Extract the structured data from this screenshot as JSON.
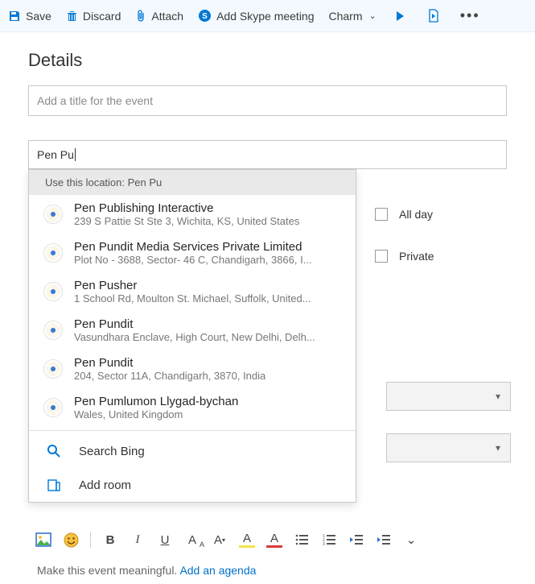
{
  "toolbar": {
    "save": "Save",
    "discard": "Discard",
    "attach": "Attach",
    "skype": "Add Skype meeting",
    "charm": "Charm"
  },
  "heading": "Details",
  "title_placeholder": "Add a title for the event",
  "location_value": "Pen Pu",
  "dropdown": {
    "use_this_prefix": "Use this location: ",
    "use_this_value": "Pen Pu",
    "items": [
      {
        "name": "Pen Publishing Interactive",
        "addr": "239 S Pattie St Ste 3, Wichita, KS, United States"
      },
      {
        "name": "Pen Pundit Media Services Private Limited",
        "addr": "Plot No - 3688, Sector- 46 C, Chandigarh, 3866, I..."
      },
      {
        "name": "Pen Pusher",
        "addr": "1 School Rd, Moulton St. Michael, Suffolk, United..."
      },
      {
        "name": "Pen Pundit",
        "addr": "Vasundhara Enclave, High Court, New Delhi, Delh..."
      },
      {
        "name": "Pen Pundit",
        "addr": "204, Sector 11A, Chandigarh, 3870, India"
      },
      {
        "name": "Pen Pumlumon Llygad-bychan",
        "addr": "Wales, United Kingdom"
      }
    ],
    "search_bing": "Search Bing",
    "add_room": "Add room"
  },
  "options": {
    "all_day": "All day",
    "private": "Private"
  },
  "body_hint": {
    "prefix": "Make this event meaningful. ",
    "link": "Add an agenda"
  }
}
